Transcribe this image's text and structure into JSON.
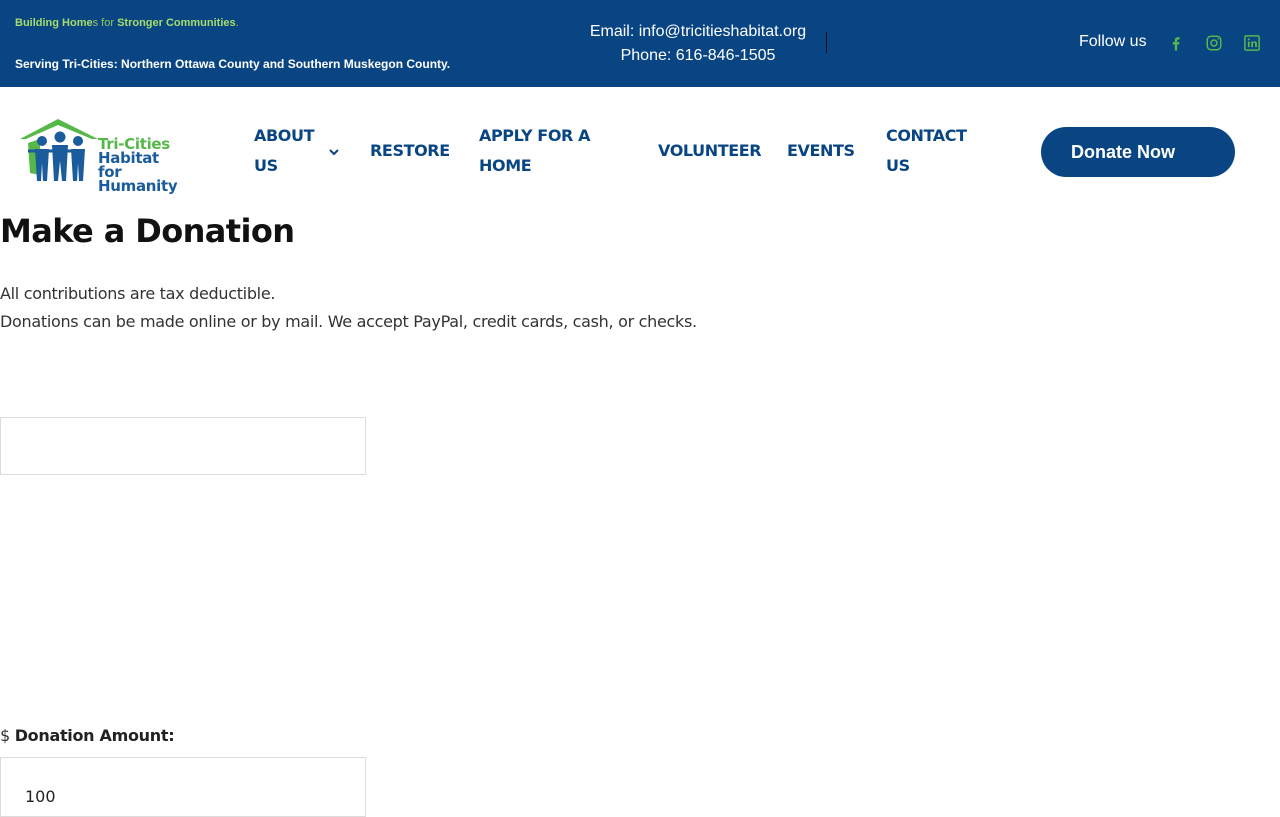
{
  "topbar": {
    "tagline": {
      "part1": "Building Home",
      "part2": "s for ",
      "part3": "Stronger Communities",
      "part4": "."
    },
    "serving": "Serving Tri-Cities: Northern Ottawa County and Southern Muskegon County.",
    "email": "Email: info@tricitieshabitat.org",
    "phone": "Phone: 616-846-1505",
    "follow": "Follow us",
    "social": [
      "facebook-icon",
      "instagram-icon",
      "linkedin-icon"
    ]
  },
  "logo": {
    "line1": "Tri-Cities",
    "line2": "Habitat for",
    "line3": "Humanity"
  },
  "nav": {
    "about_line1": "ABOUT",
    "about_line2": "US",
    "restore": "RESTORE",
    "apply_line1": "APPLY FOR A",
    "apply_line2": "HOME",
    "volunteer": "VOLUNTEER",
    "events": "EVENTS",
    "contact_line1": "CONTACT",
    "contact_line2": "US",
    "donate": "Donate Now"
  },
  "content": {
    "title": "Make a Donation",
    "line1": "All contributions are tax deductible.",
    "line2": "Donations can be made online or by mail. We accept PayPal, credit cards, cash, or checks.",
    "currency": "$",
    "amount_label": "Donation Amount:",
    "amount_value": "100"
  },
  "colors": {
    "brand_blue": "#0a4583",
    "brand_green": "#55b848"
  }
}
